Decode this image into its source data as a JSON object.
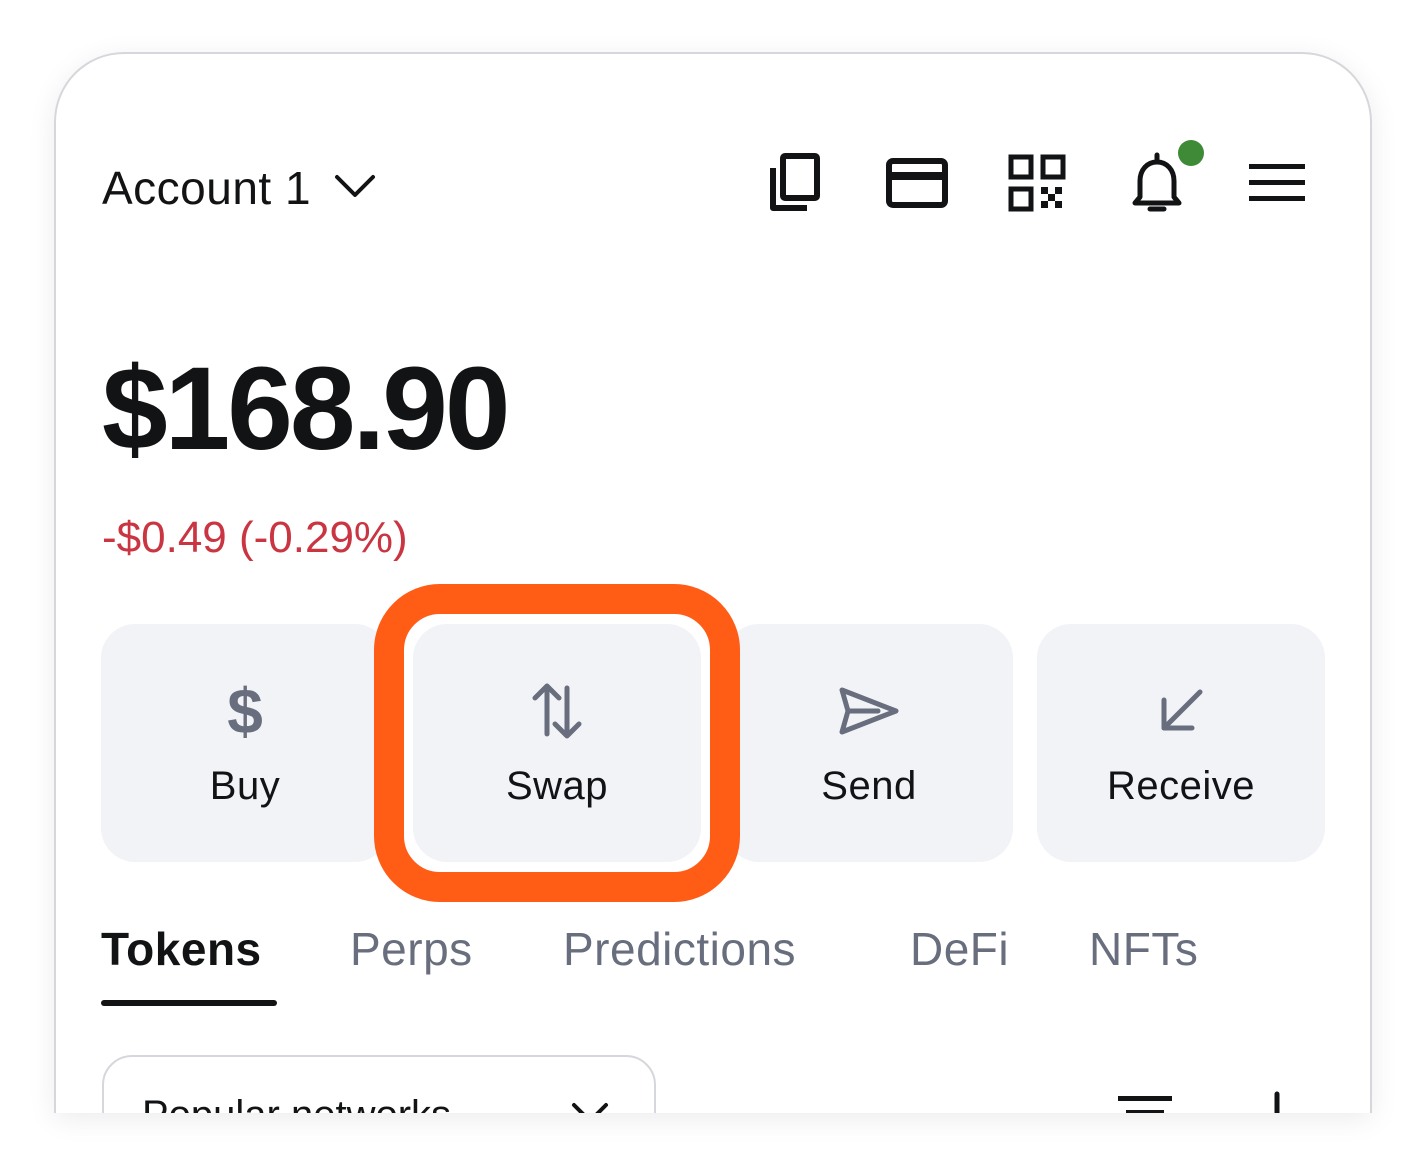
{
  "header": {
    "account_name": "Account 1",
    "icons": [
      "copy-icon",
      "card-icon",
      "qr-code-icon",
      "bell-icon",
      "menu-icon"
    ],
    "notification_dot_color": "#3f8a37"
  },
  "balance": {
    "amount": "$168.90",
    "change": "-$0.49 (-0.29%)",
    "change_color": "#ca3542"
  },
  "actions": [
    {
      "label": "Buy",
      "icon": "dollar-icon"
    },
    {
      "label": "Swap",
      "icon": "swap-arrows-icon"
    },
    {
      "label": "Send",
      "icon": "send-icon"
    },
    {
      "label": "Receive",
      "icon": "receive-arrow-icon"
    }
  ],
  "highlight_color": "#ff5c16",
  "tabs": [
    {
      "label": "Tokens",
      "active": true
    },
    {
      "label": "Perps",
      "active": false
    },
    {
      "label": "Predictions",
      "active": false
    },
    {
      "label": "DeFi",
      "active": false
    },
    {
      "label": "NFTs",
      "active": false
    }
  ],
  "network_selector": {
    "label": "Popular networks"
  },
  "colors": {
    "text_primary": "#121314",
    "text_muted": "#686e7d",
    "button_bg": "#f2f3f7"
  }
}
